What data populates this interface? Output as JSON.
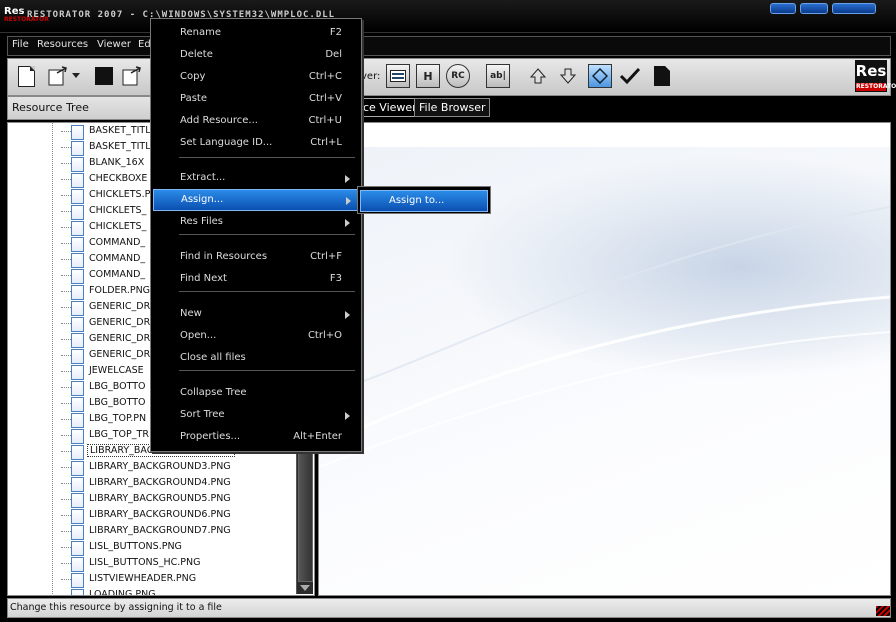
{
  "window": {
    "title": "RESTORATOR 2007 - C:\\WINDOWS\\SYSTEM32\\WMPLOC.DLL",
    "logo_text": "Res",
    "logo_subtext": "RESTORATOR"
  },
  "menubar": {
    "items": [
      "File",
      "Resources",
      "Viewer",
      "Ed"
    ]
  },
  "toolbar": {
    "viewer_label": "ver:",
    "buttons": [
      "new-icon",
      "open-icon",
      "dropdown-arrow-icon",
      "black-square-icon",
      "open-folder-icon",
      "viewer-icon",
      "hex-icon",
      "rc-icon",
      "ab-icon",
      "up-arrow-icon",
      "down-arrow-icon",
      "center-icon",
      "check-icon",
      "page-icon"
    ],
    "res_logo_text": "Res",
    "res_logo_subtext": "RESTORATOR"
  },
  "left_panel": {
    "title": "Resource Tree",
    "items": [
      "BASKET_TITL",
      "BASKET_TITL",
      "BLANK_16X",
      "CHECKBOXE",
      "CHICKLETS.P",
      "CHICKLETS_",
      "CHICKLETS_",
      "COMMAND_",
      "COMMAND_",
      "COMMAND_",
      "FOLDER.PNG",
      "GENERIC_DR",
      "GENERIC_DR",
      "GENERIC_DR",
      "GENERIC_DR",
      "JEWELCASE",
      "LBG_BOTTO",
      "LBG_BOTTO",
      "LBG_TOP.PN",
      "LBG_TOP_TR",
      "LIBRARY_BACKGROUND2.PNG",
      "LIBRARY_BACKGROUND3.PNG",
      "LIBRARY_BACKGROUND4.PNG",
      "LIBRARY_BACKGROUND5.PNG",
      "LIBRARY_BACKGROUND6.PNG",
      "LIBRARY_BACKGROUND7.PNG",
      "LISL_BUTTONS.PNG",
      "LISL_BUTTONS_HC.PNG",
      "LISTVIEWHEADER.PNG",
      "LOADING.PNG"
    ],
    "selected_index": 20
  },
  "right_panel": {
    "tabs": [
      "ce Viewer",
      "File Browser"
    ],
    "active_tab": 0
  },
  "context_menu": {
    "items": [
      {
        "label": "Rename",
        "key": "F2"
      },
      {
        "label": "Delete",
        "key": "Del"
      },
      {
        "label": "Copy",
        "key": "Ctrl+C"
      },
      {
        "label": "Paste",
        "key": "Ctrl+V"
      },
      {
        "label": "Add Resource...",
        "key": "Ctrl+U"
      },
      {
        "label": "Set Language ID...",
        "key": "Ctrl+L"
      },
      {
        "label": "Extract...",
        "key": ""
      },
      {
        "label": "Assign...",
        "key": ""
      },
      {
        "label": "Res Files",
        "key": ""
      },
      {
        "label": "Find in Resources",
        "key": "Ctrl+F"
      },
      {
        "label": "Find Next",
        "key": "F3"
      },
      {
        "label": "New",
        "key": ""
      },
      {
        "label": "Open...",
        "key": "Ctrl+O"
      },
      {
        "label": "Close all files",
        "key": ""
      },
      {
        "label": "Collapse Tree",
        "key": ""
      },
      {
        "label": "Sort Tree",
        "key": ""
      },
      {
        "label": "Properties...",
        "key": "Alt+Enter"
      }
    ],
    "highlighted": "Assign..."
  },
  "submenu": {
    "items": [
      "Assign to..."
    ]
  },
  "statusbar": {
    "text": "Change this resource by assigning it to a file"
  },
  "colors": {
    "highlight_top": "#2b8be8",
    "highlight_bottom": "#0b4fb0",
    "logo_red": "#cc0000"
  }
}
